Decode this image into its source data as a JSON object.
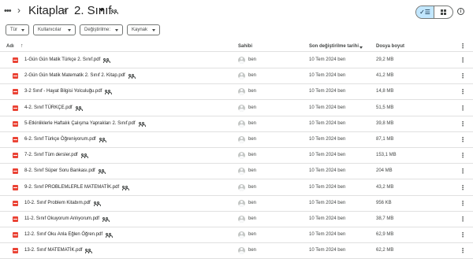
{
  "breadcrumb": {
    "more": "•••",
    "separator": "›",
    "parent": "Kitaplar",
    "current": "2. Sınıf"
  },
  "filters": {
    "type": "Tür",
    "people": "Kullanıcılar",
    "modified": "Değiştirilme:",
    "source": "Kaynak"
  },
  "view": {
    "list_icon": "check-list-icon",
    "grid_icon": "grid-icon",
    "info": "i"
  },
  "columns": {
    "name": "Adı",
    "sort": "↑",
    "owner": "Sahibi",
    "modified": "Son değiştirilme tarihi",
    "size": "Dosya boyut",
    "more": "⋮"
  },
  "files": [
    {
      "name": "1-Gün Gün Matik Türkçe 2. Sınıf.pdf",
      "owner": "ben",
      "modified": "10 Tem 2024 ben",
      "size": "29,2 MB"
    },
    {
      "name": "2-Gün Gün Matik Matematik 2. Sınıf 2. Kitap.pdf",
      "owner": "ben",
      "modified": "10 Tem 2024 ben",
      "size": "41,2 MB"
    },
    {
      "name": "3-2 Sınıf - Hayat Bilgisi Yolculuğu.pdf",
      "owner": "ben",
      "modified": "10 Tem 2024 ben",
      "size": "14,8 MB"
    },
    {
      "name": "4-2. Sınıf TÜRKÇE.pdf",
      "owner": "ben",
      "modified": "10 Tem 2024 ben",
      "size": "51,5 MB"
    },
    {
      "name": "5-Etkinliklerle Haftalık Çalışma Yaprakları 2. Sınıf.pdf",
      "owner": "ben",
      "modified": "10 Tem 2024 ben",
      "size": "39,8 MB"
    },
    {
      "name": "6-2. Sınıf Türkçe Öğreniyorum.pdf",
      "owner": "ben",
      "modified": "10 Tem 2024 ben",
      "size": "87,1 MB"
    },
    {
      "name": "7-2. Sınıf Tüm dersler.pdf",
      "owner": "ben",
      "modified": "10 Tem 2024 ben",
      "size": "153,1 MB"
    },
    {
      "name": "8-2. Sınıf Süper Soru Bankası.pdf",
      "owner": "ben",
      "modified": "10 Tem 2024 ben",
      "size": "204 MB"
    },
    {
      "name": "9-2. Sınıf PROBLEMLERLE MATEMATİK.pdf",
      "owner": "ben",
      "modified": "10 Tem 2024 ben",
      "size": "43,2 MB"
    },
    {
      "name": "10-2. Sınıf Problem Kitabım.pdf",
      "owner": "ben",
      "modified": "10 Tem 2024 ben",
      "size": "956 KB"
    },
    {
      "name": "11-2. Sınıf Okuyorum Anlıyorum.pdf",
      "owner": "ben",
      "modified": "10 Tem 2024 ben",
      "size": "38,7 MB"
    },
    {
      "name": "12-2. Sınıf Oku Anla Eğlen Öğren.pdf",
      "owner": "ben",
      "modified": "10 Tem 2024 ben",
      "size": "62,9 MB"
    },
    {
      "name": "13-2. Sınıf MATEMATİK.pdf",
      "owner": "ben",
      "modified": "10 Tem 2024 ben",
      "size": "62,2 MB"
    }
  ],
  "colors": {
    "accent": "#c2e7ff",
    "pdf": "#ea4335",
    "divider": "#e0e0e0"
  }
}
